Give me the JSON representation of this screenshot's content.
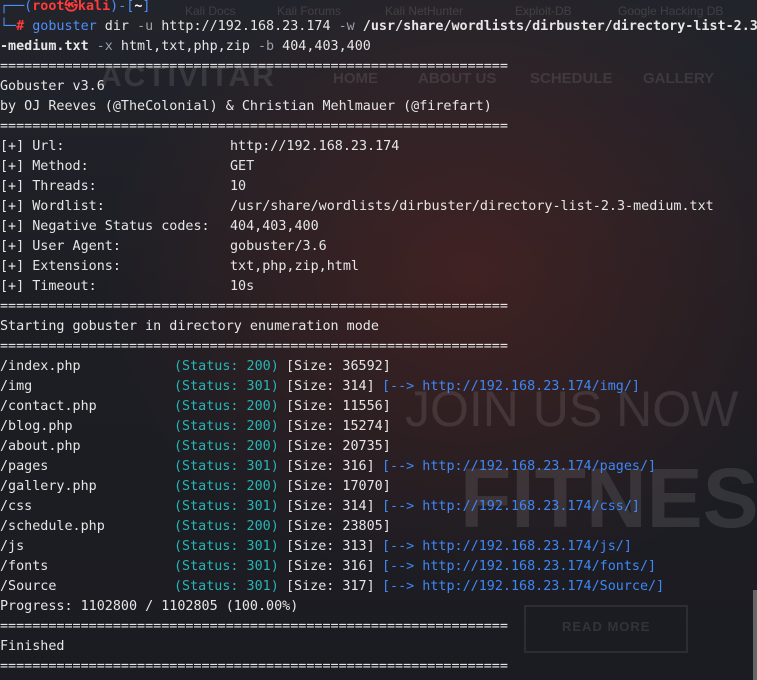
{
  "prompt": {
    "user": "root",
    "at": "㉿",
    "host": "kali",
    "dir": "~",
    "symbol": "#"
  },
  "command": {
    "program": "gobuster",
    "sub": " dir ",
    "flag_u": "-u",
    "url": " http://192.168.23.174 ",
    "flag_w": "-w",
    "wordlist_a": " /usr/share/wordlists/dirbuster/directory-list-2.3",
    "wordlist_b": "-medium.txt",
    "flag_x": " -x",
    "ext": " html,txt,php,zip ",
    "flag_b": "-b",
    "codes": " 404,403,400"
  },
  "separator": "===============================================================",
  "banner": {
    "title": "Gobuster v3.6",
    "authors": "by OJ Reeves (@TheColonial) & Christian Mehlmauer (@firefart)"
  },
  "config": [
    {
      "key": "[+] Url:",
      "value": "http://192.168.23.174"
    },
    {
      "key": "[+] Method:",
      "value": "GET"
    },
    {
      "key": "[+] Threads:",
      "value": "10"
    },
    {
      "key": "[+] Wordlist:",
      "value": "/usr/share/wordlists/dirbuster/directory-list-2.3-medium.txt"
    },
    {
      "key": "[+] Negative Status codes:",
      "value": "404,403,400"
    },
    {
      "key": "[+] User Agent:",
      "value": "gobuster/3.6"
    },
    {
      "key": "[+] Extensions:",
      "value": "txt,php,zip,html"
    },
    {
      "key": "[+] Timeout:",
      "value": "10s"
    }
  ],
  "start_msg": "Starting gobuster in directory enumeration mode",
  "results": [
    {
      "path": "/index.php",
      "status": "(Status: 200)",
      "size": "[Size: 36592]",
      "redirect": ""
    },
    {
      "path": "/img",
      "status": "(Status: 301)",
      "size": "[Size: 314]",
      "redirect": "[--> http://192.168.23.174/img/]"
    },
    {
      "path": "/contact.php",
      "status": "(Status: 200)",
      "size": "[Size: 11556]",
      "redirect": ""
    },
    {
      "path": "/blog.php",
      "status": "(Status: 200)",
      "size": "[Size: 15274]",
      "redirect": ""
    },
    {
      "path": "/about.php",
      "status": "(Status: 200)",
      "size": "[Size: 20735]",
      "redirect": ""
    },
    {
      "path": "/pages",
      "status": "(Status: 301)",
      "size": "[Size: 316]",
      "redirect": "[--> http://192.168.23.174/pages/]"
    },
    {
      "path": "/gallery.php",
      "status": "(Status: 200)",
      "size": "[Size: 17070]",
      "redirect": ""
    },
    {
      "path": "/css",
      "status": "(Status: 301)",
      "size": "[Size: 314]",
      "redirect": "[--> http://192.168.23.174/css/]"
    },
    {
      "path": "/schedule.php",
      "status": "(Status: 200)",
      "size": "[Size: 23805]",
      "redirect": ""
    },
    {
      "path": "/js",
      "status": "(Status: 301)",
      "size": "[Size: 313]",
      "redirect": "[--> http://192.168.23.174/js/]"
    },
    {
      "path": "/fonts",
      "status": "(Status: 301)",
      "size": "[Size: 316]",
      "redirect": "[--> http://192.168.23.174/fonts/]"
    },
    {
      "path": "/Source",
      "status": "(Status: 301)",
      "size": "[Size: 317]",
      "redirect": "[--> http://192.168.23.174/Source/]"
    }
  ],
  "progress": "Progress: 1102800 / 1102805 (100.00%)",
  "finished": "Finished",
  "background": {
    "brand": "ACTIVITAR",
    "nav": [
      "HOME",
      "ABOUT US",
      "SCHEDULE",
      "GALLERY"
    ],
    "bookmarks": [
      "Kali Docs",
      "Kali Forums",
      "Kali NetHunter",
      "Exploit-DB",
      "Google Hacking DB"
    ],
    "hero_1": "JOIN US NOW",
    "hero_2": "FITNESS & SP",
    "button": "READ MORE"
  }
}
